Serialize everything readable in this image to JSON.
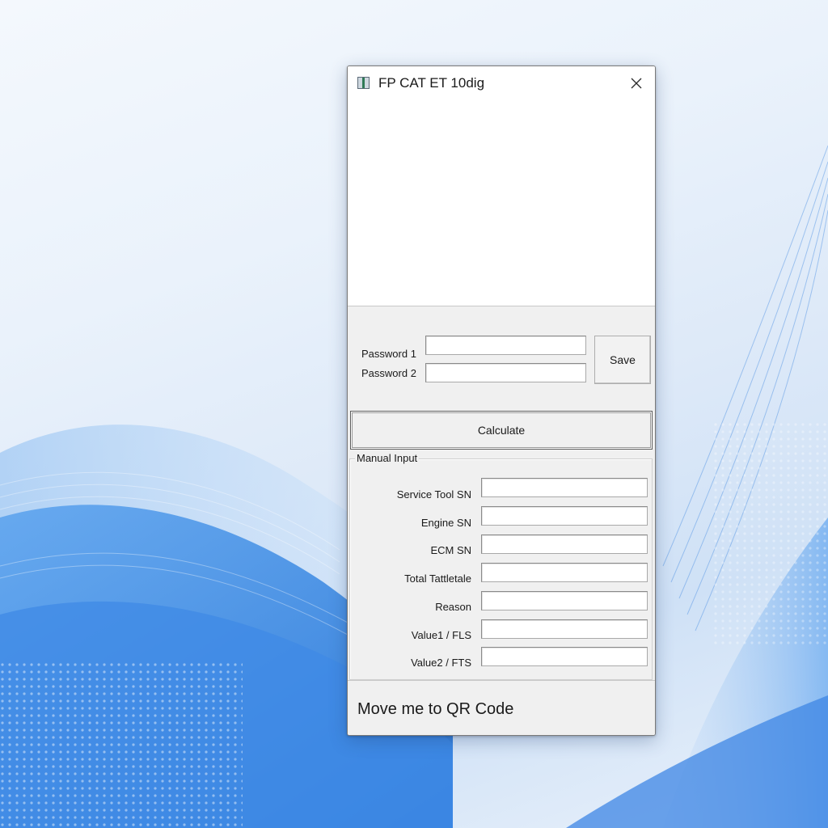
{
  "window": {
    "title": "FP CAT ET 10dig",
    "icon": "app-icon",
    "close_icon": "close-icon"
  },
  "passwords": {
    "password1_label": "Password 1",
    "password1_value": "",
    "password2_label": "Password 2",
    "password2_value": "",
    "save_label": "Save"
  },
  "calculate_label": "Calculate",
  "manual_input": {
    "title": "Manual Input",
    "fields": [
      {
        "label": "Service Tool SN",
        "value": ""
      },
      {
        "label": "Engine SN",
        "value": ""
      },
      {
        "label": "ECM SN",
        "value": ""
      },
      {
        "label": "Total Tattletale",
        "value": ""
      },
      {
        "label": "Reason",
        "value": ""
      },
      {
        "label": "Value1 / FLS",
        "value": ""
      },
      {
        "label": "Value2 / FTS",
        "value": ""
      }
    ]
  },
  "footer_label": "Move me to QR Code",
  "colors": {
    "window_bg": "#f0f0f0",
    "panel_white": "#ffffff",
    "desktop_accent": "#2f7fe0"
  }
}
